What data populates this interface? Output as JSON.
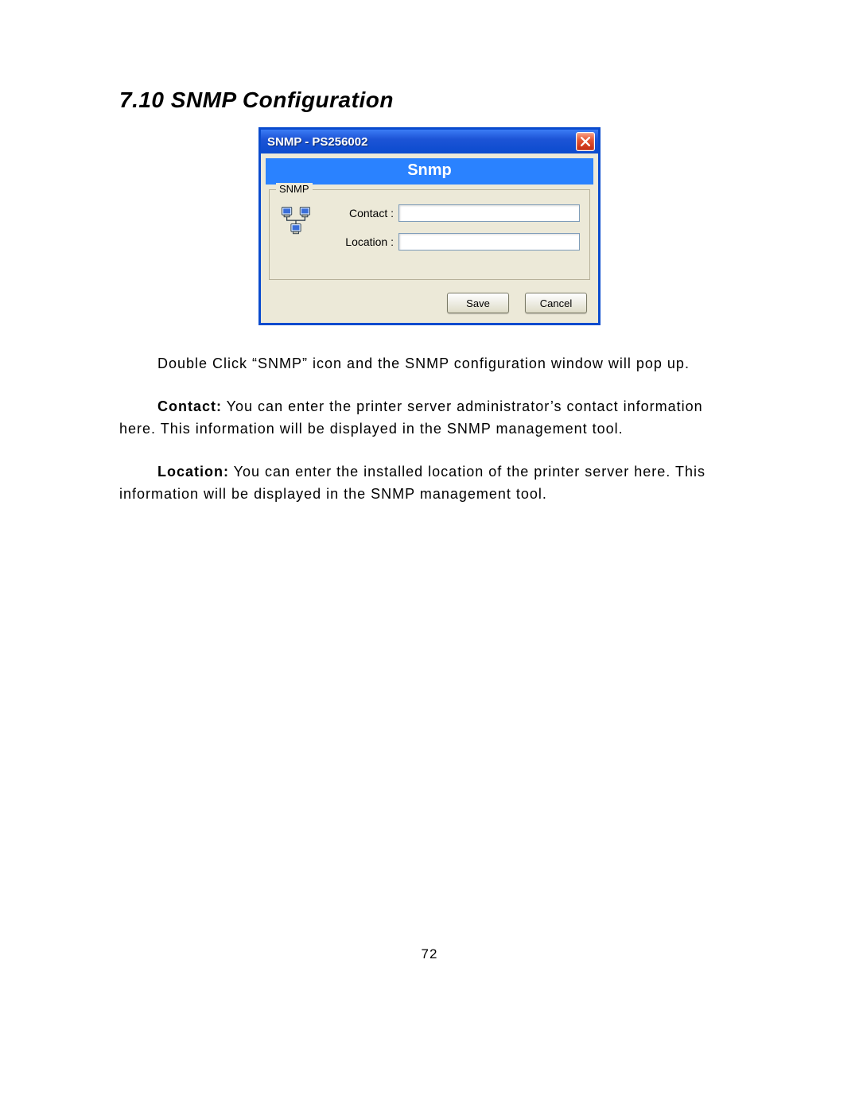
{
  "heading": "7.10   SNMP Configuration",
  "dialog": {
    "title": "SNMP - PS256002",
    "banner": "Snmp",
    "group_legend": "SNMP",
    "contact_label": "Contact :",
    "location_label": "Location :",
    "contact_value": "",
    "location_value": "",
    "save_label": "Save",
    "cancel_label": "Cancel"
  },
  "para1": "Double Click “SNMP” icon and the SNMP configuration window will pop up.",
  "para2_lead": "Contact:",
  "para2_rest": " You can enter the printer server administrator’s contact information here. This information will be displayed in the SNMP management tool.",
  "para3_lead": "Location:",
  "para3_rest": " You can enter the installed location of the printer server here. This information will be displayed in the SNMP management tool.",
  "page_number": "72"
}
